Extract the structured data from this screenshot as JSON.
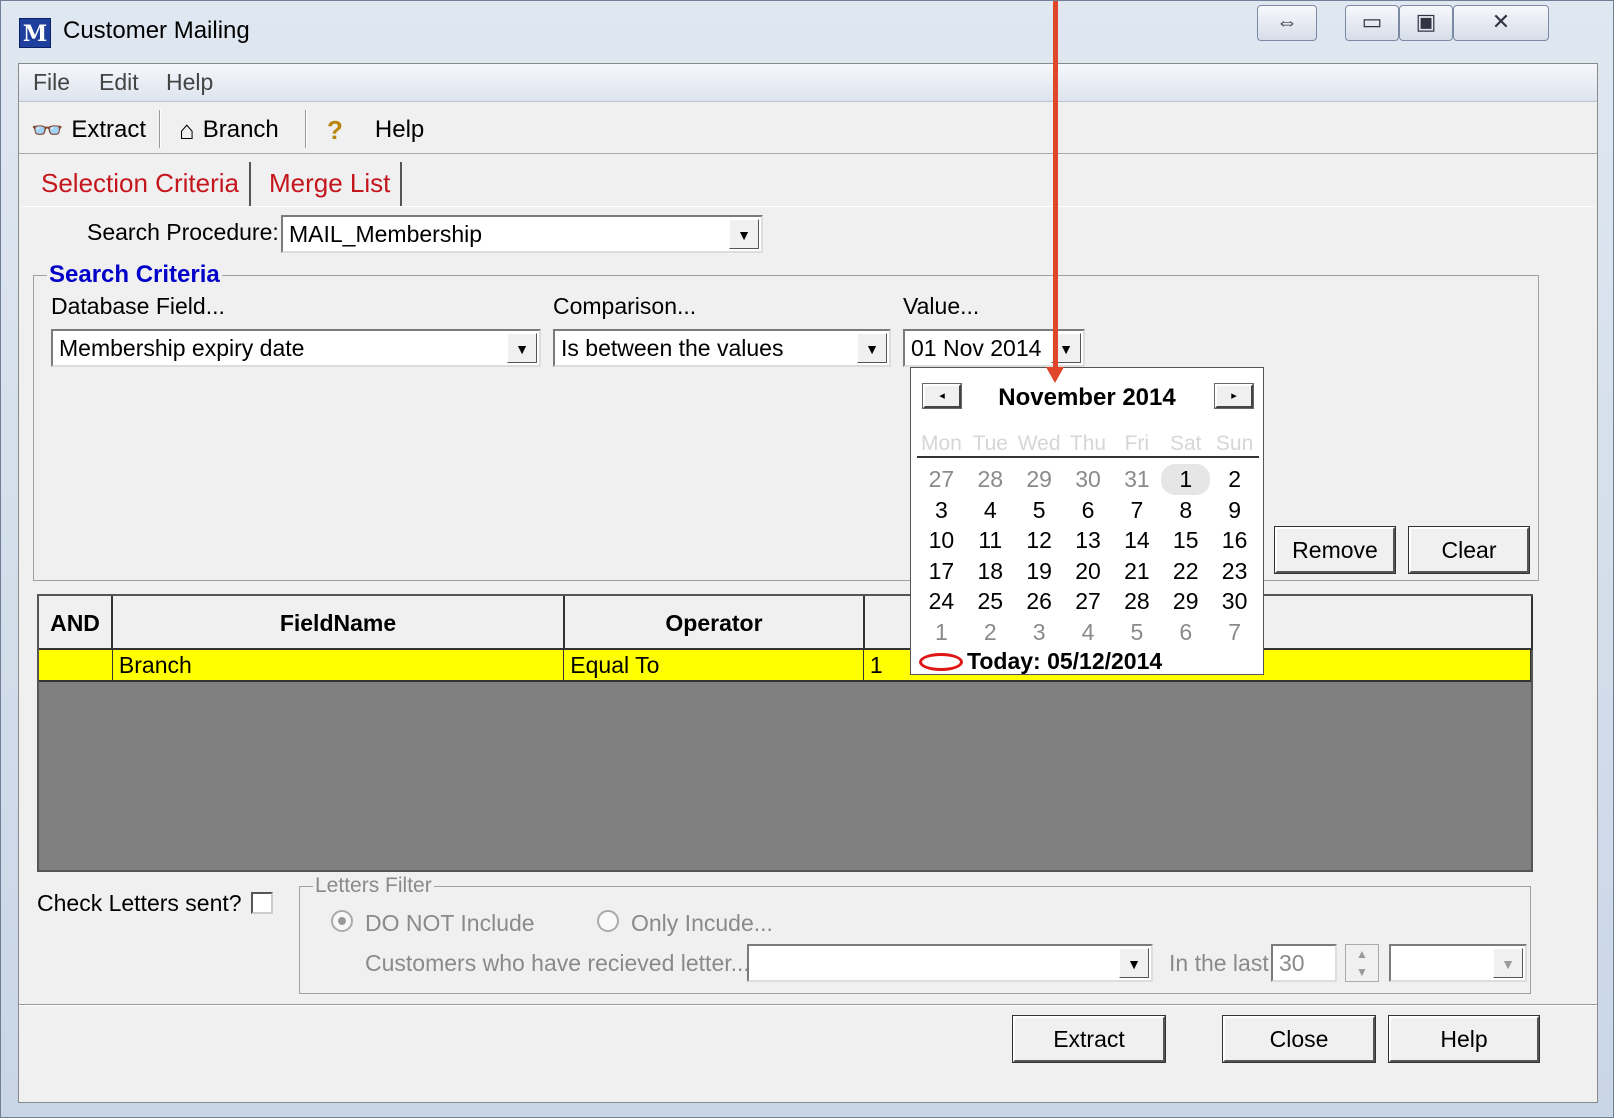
{
  "window": {
    "title": "Customer Mailing",
    "app_icon_text": "M",
    "caption_buttons": [
      "⇔",
      "▭",
      "▣",
      "✕"
    ]
  },
  "menu": [
    "File",
    "Edit",
    "Help"
  ],
  "toolbar": {
    "extract_label": "Extract",
    "branch_label": "Branch",
    "help_label": "Help",
    "extract_icon": "binoculars-icon",
    "branch_icon": "house-icon",
    "help_icon": "question-icon"
  },
  "tabs": [
    "Selection Criteria",
    "Merge List"
  ],
  "search": {
    "procedure_label": "Search Procedure:",
    "procedure_value": "MAIL_Membership",
    "criteria_title": "Search Criteria",
    "field_label": "Database Field...",
    "field_value": "Membership expiry date",
    "comparison_label": "Comparison...",
    "comparison_value": "Is between the values",
    "value_label": "Value...",
    "value_value": "01 Nov 2014"
  },
  "buttons": {
    "remove": "Remove",
    "clear": "Clear",
    "extract": "Extract",
    "close": "Close",
    "help": "Help"
  },
  "grid": {
    "columns": [
      "AND",
      "FieldName",
      "Operator",
      ""
    ],
    "rows": [
      {
        "and": "",
        "fieldname": "Branch",
        "operator": "Equal To",
        "value": "1"
      }
    ]
  },
  "calendar": {
    "title": "November 2014",
    "prev": "◂",
    "next": "▸",
    "dow": [
      "Mon",
      "Tue",
      "Wed",
      "Thu",
      "Fri",
      "Sat",
      "Sun"
    ],
    "weeks": [
      [
        "27",
        "28",
        "29",
        "30",
        "31",
        "1",
        "2"
      ],
      [
        "3",
        "4",
        "5",
        "6",
        "7",
        "8",
        "9"
      ],
      [
        "10",
        "11",
        "12",
        "13",
        "14",
        "15",
        "16"
      ],
      [
        "17",
        "18",
        "19",
        "20",
        "21",
        "22",
        "23"
      ],
      [
        "24",
        "25",
        "26",
        "27",
        "28",
        "29",
        "30"
      ],
      [
        "1",
        "2",
        "3",
        "4",
        "5",
        "6",
        "7"
      ]
    ],
    "today": "Today: 05/12/2014"
  },
  "letters": {
    "check_label": "Check Letters sent?",
    "filter_title": "Letters Filter",
    "option_not_include": "DO NOT Include",
    "option_only_include": "Only Incude...",
    "received_label": "Customers who have recieved letter...",
    "in_last_label": "In the last",
    "in_last_value": "30"
  },
  "colors": {
    "tab_text": "#c4161c",
    "group_title": "#0000c8",
    "row_highlight": "#ffff00",
    "annotation_arrow": "#e0472a"
  }
}
